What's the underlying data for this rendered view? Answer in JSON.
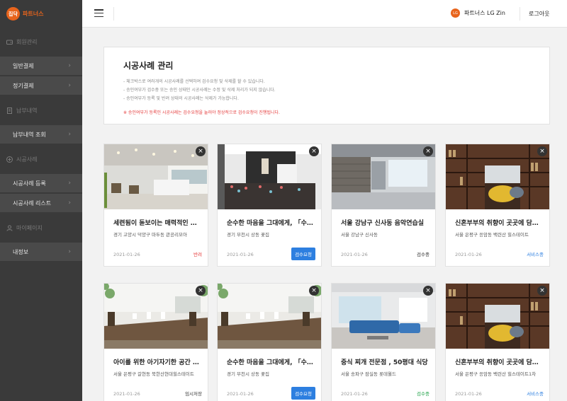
{
  "app": {
    "logo_badge": "집닥",
    "logo_text": "파트너스"
  },
  "sidebar": {
    "sections": [
      {
        "title": "회원관리",
        "icon": "wallet-icon",
        "items": [
          "일반결제",
          "정기결제"
        ]
      },
      {
        "title": "납부내역",
        "icon": "receipt-icon",
        "items": [
          "납부내역 조회"
        ]
      },
      {
        "title": "시공사례",
        "icon": "plus-circle-icon",
        "items": [
          "시공사례 등록",
          "시공사례 리스트"
        ]
      },
      {
        "title": "마이페이지",
        "icon": "user-icon",
        "items": [
          "내정보"
        ]
      }
    ]
  },
  "topbar": {
    "partner_name": "파트너스 LG Zin",
    "partner_logo": "LG",
    "logout": "로그아웃"
  },
  "panel": {
    "title": "시공사례 관리",
    "notes": [
      "- 체크박스로 여러개의 시공사례를 선택하여 검수요청 및 삭제를 할 수 있습니다.",
      "- 승인여부가 검수중 또는 승인 상태인 시공사례는 수정 및 삭제 처리가 되지 않습니다.",
      "- 승인여부가 등록 및 반려 상태의 시공사례는 삭제가 가능합니다."
    ],
    "warning": "※ 승인여부가 등록인 시공사례는 검수요청을 눌러야 정상적으로 검수요청이 진행됩니다."
  },
  "cards": [
    {
      "title": "세련됨이 돋보이는 매력적인 사무실",
      "address": "경기 고양시 덕양구 마두동 관공리모아",
      "date": "2021-01-26",
      "status": "반려",
      "status_type": "red",
      "scene": "office"
    },
    {
      "title": "순수한 마음을 그대에게, 「수제 카페」",
      "address": "경기 부천시 상동 꽃집",
      "date": "2021-01-26",
      "status": "검수요청",
      "status_type": "btn",
      "scene": "cafe"
    },
    {
      "title": "서울 강남구 신사동 음악연습실",
      "address": "서울 강남구 신사동",
      "date": "2021-01-26",
      "status": "검수중",
      "status_type": "dark",
      "scene": "studio"
    },
    {
      "title": "신혼부부의 취향이 곳곳에 담겨있는 집",
      "address": "서울 은평구 응암동 백련산 힐스테이트",
      "date": "2021-01-26",
      "status": "서비스중",
      "status_type": "blue",
      "scene": "library"
    },
    {
      "title": "아이를 위한 아기자기한 공간 만들기",
      "address": "서울 은평구 갈현동 북한산현대힐스테이트",
      "date": "2021-01-26",
      "status": "임시저장",
      "status_type": "dark",
      "scene": "dining"
    },
    {
      "title": "순수한 마음을 그대에게, 「수제 카페」",
      "address": "경기 부천시 상동 꽃집",
      "date": "2021-01-26",
      "status": "검수요청",
      "status_type": "btn",
      "scene": "dining"
    },
    {
      "title": "중식 찌개 전문점 , 50평대 식당",
      "address": "서울 송파구 잠실동 롯데월드",
      "date": "2021-01-26",
      "status": "검수중",
      "status_type": "green",
      "scene": "living"
    },
    {
      "title": "신혼부부의 취향이 곳곳에 담겨있는 집",
      "address": "서울 은평구 응암동 백련산 힐스테이트1차",
      "date": "2021-01-26",
      "status": "서비스중",
      "status_type": "blue",
      "scene": "library"
    }
  ],
  "colors": {
    "accent": "#e8641c",
    "sidebar_bg": "#3a3a3a",
    "primary": "#2d7fe0",
    "danger": "#e53b3b"
  }
}
